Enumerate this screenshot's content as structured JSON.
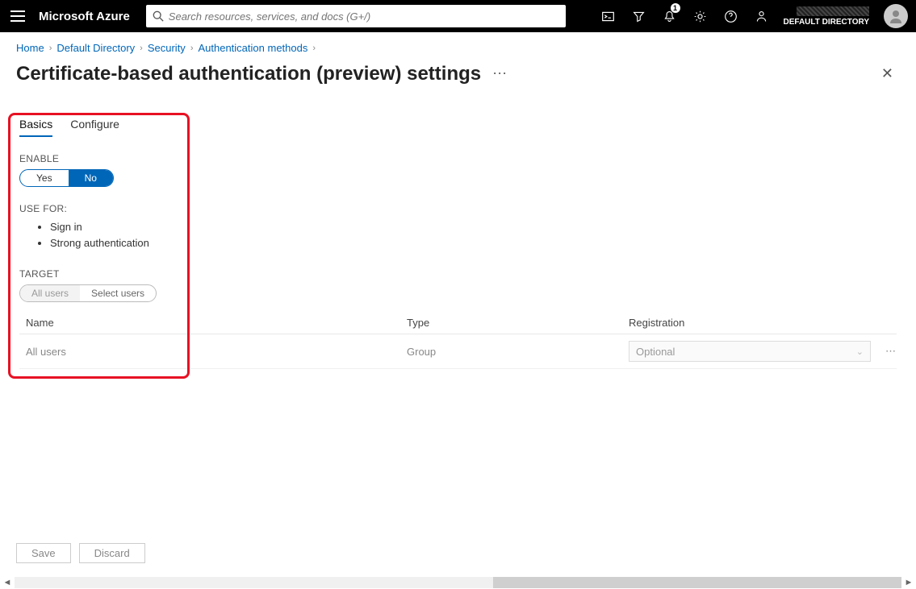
{
  "brand": "Microsoft Azure",
  "search": {
    "placeholder": "Search resources, services, and docs (G+/)"
  },
  "notifications": {
    "count": "1"
  },
  "tenant": {
    "label": "DEFAULT DIRECTORY"
  },
  "breadcrumb": {
    "items": [
      "Home",
      "Default Directory",
      "Security",
      "Authentication methods"
    ]
  },
  "page": {
    "title": "Certificate-based authentication (preview) settings"
  },
  "tabs": {
    "basics": "Basics",
    "configure": "Configure",
    "active": "basics"
  },
  "enable": {
    "label": "ENABLE",
    "yes": "Yes",
    "no": "No",
    "value": "No"
  },
  "use_for": {
    "label": "USE FOR:",
    "items": [
      "Sign in",
      "Strong authentication"
    ]
  },
  "target": {
    "label": "TARGET",
    "all": "All users",
    "select": "Select users",
    "value": "All users"
  },
  "table": {
    "headers": {
      "name": "Name",
      "type": "Type",
      "registration": "Registration"
    },
    "rows": [
      {
        "name": "All users",
        "type": "Group",
        "registration": "Optional"
      }
    ]
  },
  "footer": {
    "save": "Save",
    "discard": "Discard"
  }
}
